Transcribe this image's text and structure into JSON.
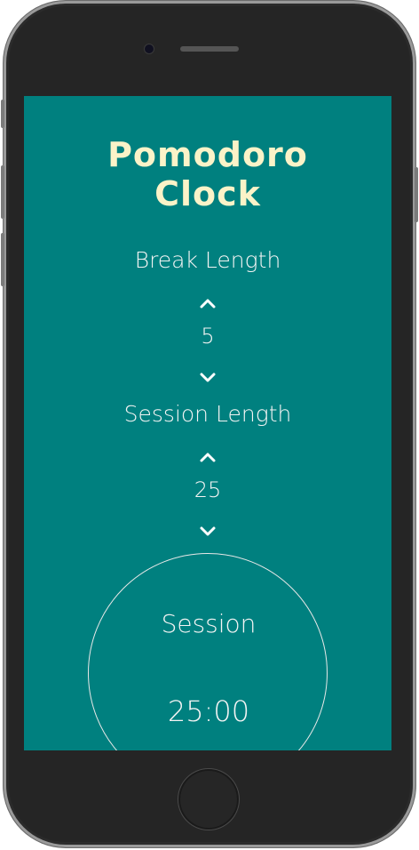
{
  "app": {
    "title": "Pomodoro\nClock"
  },
  "break": {
    "label": "Break Length",
    "value": "5"
  },
  "session": {
    "label": "Session Length",
    "value": "25"
  },
  "timer": {
    "label": "Session",
    "time": "25:00"
  },
  "icons": {
    "increment": "chevron-up-icon",
    "decrement": "chevron-down-icon"
  },
  "colors": {
    "background": "#00807f",
    "title": "#fbf3c8",
    "text": "#f4f4f4",
    "device": "#2b2b2b"
  }
}
